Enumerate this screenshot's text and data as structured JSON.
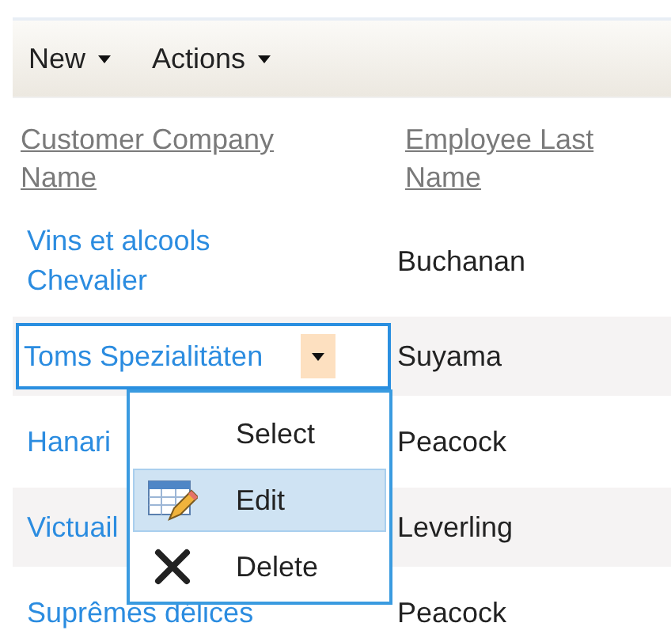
{
  "toolbar": [
    {
      "label": "New"
    },
    {
      "label": "Actions"
    }
  ],
  "columns": [
    "Customer Company Name",
    "Employee Last Name"
  ],
  "rows": [
    {
      "customer": "Vins et alcools Chevalier",
      "employee": "Buchanan",
      "selected": false
    },
    {
      "customer": "Toms Spezialitäten",
      "employee": "Suyama",
      "selected": true
    },
    {
      "customer": "Hanari",
      "employee": "Peacock",
      "selected": false
    },
    {
      "customer": "Victuail",
      "employee": "Leverling",
      "selected": false
    },
    {
      "customer": "Suprêmes délices",
      "employee": "Peacock",
      "selected": false
    }
  ],
  "context_menu": {
    "items": [
      {
        "kind": "plain",
        "label": "Select",
        "selected": false
      },
      {
        "kind": "edit",
        "label": "Edit",
        "selected": true
      },
      {
        "kind": "delete",
        "label": "Delete",
        "selected": false
      }
    ]
  }
}
